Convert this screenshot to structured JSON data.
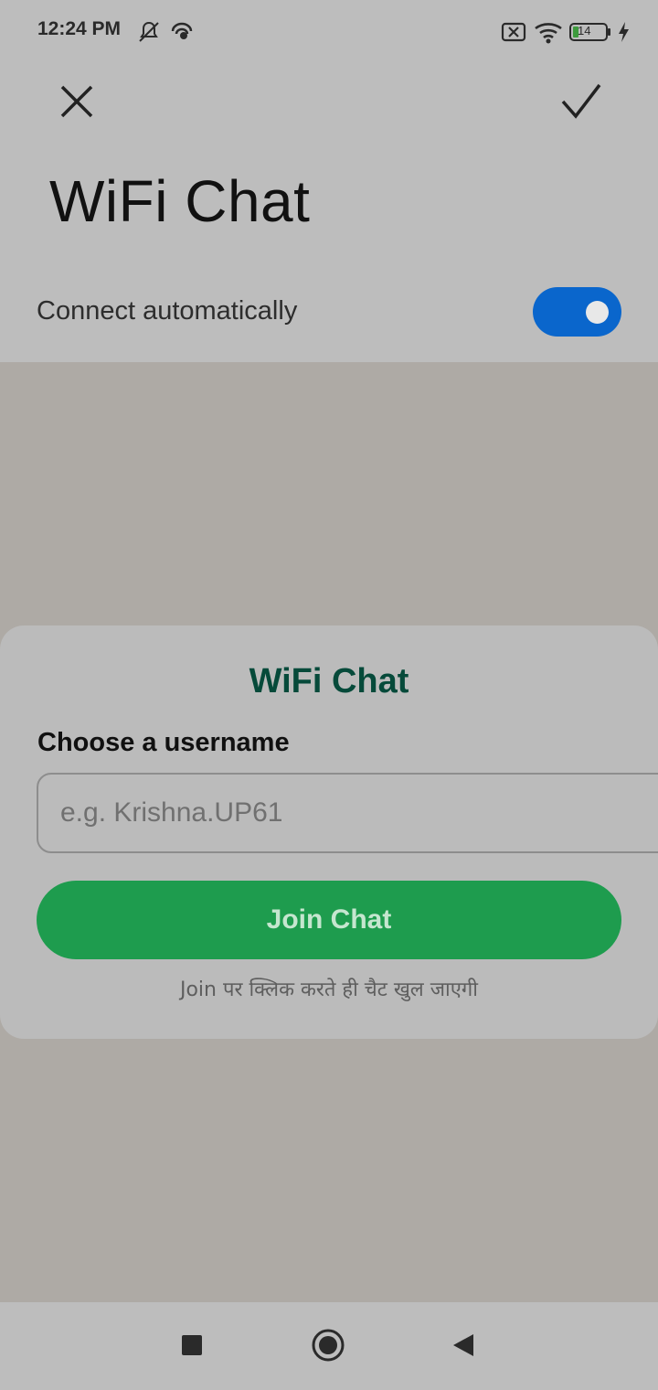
{
  "status_bar": {
    "time": "12:24 PM",
    "icons": [
      "notifications-off-icon",
      "hotspot-icon",
      "sim-off-icon",
      "wifi-icon",
      "battery-icon",
      "charging-icon"
    ],
    "battery_level": "14"
  },
  "header": {
    "close_icon": "close-icon",
    "confirm_icon": "check-icon",
    "title": "WiFi Chat"
  },
  "settings": {
    "auto_connect_label": "Connect automatically",
    "auto_connect_enabled": true,
    "toggle_color": "#0a66cc"
  },
  "dialog": {
    "title": "WiFi Chat",
    "field_label": "Choose a username",
    "username_placeholder": "e.g. Krishna.UP61",
    "username_value": "",
    "join_button_label": "Join Chat",
    "hint": "Join पर क्लिक करते ही चैट खुल जाएगी",
    "title_color": "#064a3a",
    "button_color": "#1e9c4e"
  },
  "nav_bar": {
    "recents_icon": "recents-icon",
    "home_icon": "home-icon",
    "back_icon": "back-icon"
  }
}
